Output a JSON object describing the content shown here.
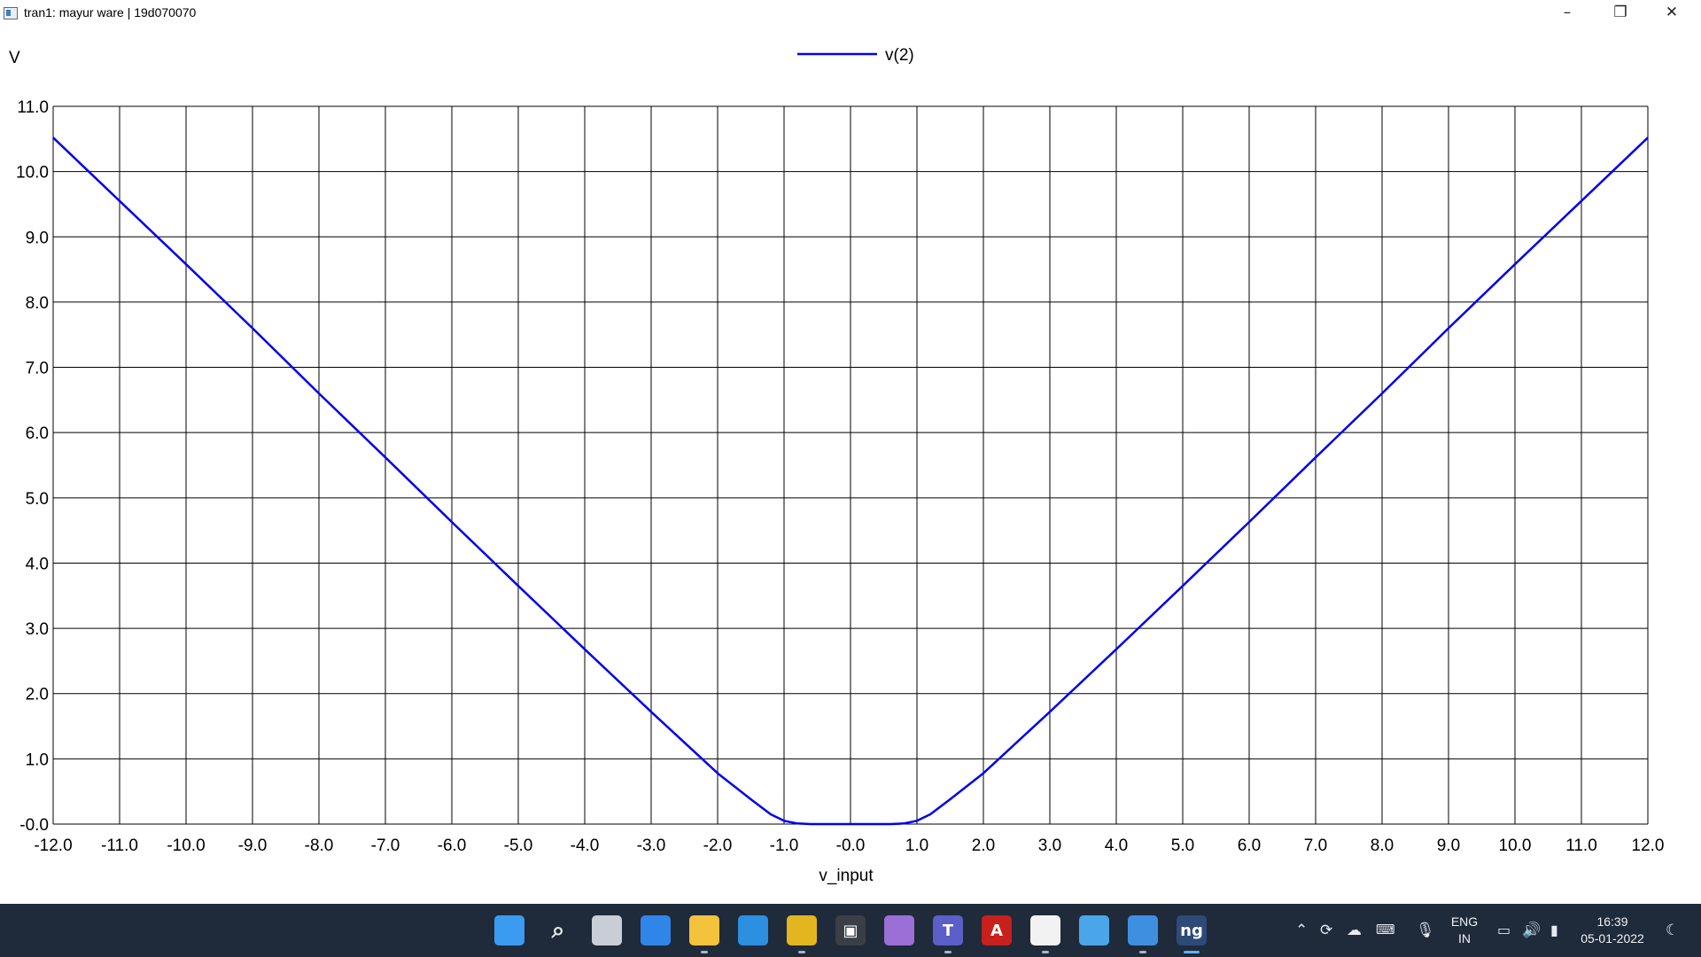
{
  "window": {
    "title": "tran1: mayur ware | 19d070070",
    "controls": {
      "minimize": "–",
      "maximize": "❐",
      "close": "✕"
    }
  },
  "chart_data": {
    "type": "line",
    "title": "",
    "xlabel": "v_input",
    "ylabel": "V",
    "xlim": [
      -12,
      12
    ],
    "ylim": [
      0,
      11
    ],
    "grid": true,
    "legend_position": "top-center",
    "x_ticks": [
      "-12.0",
      "-11.0",
      "-10.0",
      "-9.0",
      "-8.0",
      "-7.0",
      "-6.0",
      "-5.0",
      "-4.0",
      "-3.0",
      "-2.0",
      "-1.0",
      "-0.0",
      "1.0",
      "2.0",
      "3.0",
      "4.0",
      "5.0",
      "6.0",
      "7.0",
      "8.0",
      "9.0",
      "10.0",
      "11.0",
      "12.0"
    ],
    "y_ticks": [
      "-0.0",
      "1.0",
      "2.0",
      "3.0",
      "4.0",
      "5.0",
      "6.0",
      "7.0",
      "8.0",
      "9.0",
      "10.0",
      "11.0"
    ],
    "series": [
      {
        "name": "v(2)",
        "color": "#0000ee",
        "x": [
          -12,
          -11,
          -10,
          -9,
          -8,
          -7,
          -6,
          -5,
          -4,
          -3,
          -2,
          -1.5,
          -1.2,
          -1.0,
          -0.8,
          -0.6,
          0,
          0.6,
          0.8,
          1.0,
          1.2,
          1.5,
          2,
          3,
          4,
          5,
          6,
          7,
          8,
          9,
          10,
          11,
          12
        ],
        "y": [
          10.52,
          9.55,
          8.58,
          7.6,
          6.6,
          5.62,
          4.63,
          3.65,
          2.68,
          1.72,
          0.78,
          0.38,
          0.15,
          0.05,
          0.01,
          0.0,
          0.0,
          0.0,
          0.01,
          0.05,
          0.15,
          0.38,
          0.78,
          1.72,
          2.68,
          3.65,
          4.63,
          5.62,
          6.6,
          7.6,
          8.58,
          9.55,
          10.52
        ]
      }
    ]
  },
  "taskbar": {
    "apps": [
      {
        "name": "start-icon",
        "glyph": "",
        "color": "#3a9bf0"
      },
      {
        "name": "search-icon",
        "glyph": "⌕",
        "color": "#1f2a3a"
      },
      {
        "name": "task-view-icon",
        "glyph": "",
        "color": "#c9ced6"
      },
      {
        "name": "widgets-icon",
        "glyph": "",
        "color": "#2f86e8"
      },
      {
        "name": "file-explorer-icon",
        "glyph": "",
        "color": "#f4c23c"
      },
      {
        "name": "vscode-icon",
        "glyph": "",
        "color": "#2c8fe0"
      },
      {
        "name": "chrome-icon",
        "glyph": "",
        "color": "#e3b51f"
      },
      {
        "name": "terminal-icon",
        "glyph": "▣",
        "color": "#3a3f47"
      },
      {
        "name": "github-icon",
        "glyph": "",
        "color": "#9a6fd6"
      },
      {
        "name": "teams-icon",
        "glyph": "T",
        "color": "#5b5fc7"
      },
      {
        "name": "acrobat-icon",
        "glyph": "A",
        "color": "#c8201d"
      },
      {
        "name": "gtkwave-icon",
        "glyph": "",
        "color": "#f2f2f2"
      },
      {
        "name": "paint-icon",
        "glyph": "",
        "color": "#4aa6e8"
      },
      {
        "name": "notepad-icon",
        "glyph": "",
        "color": "#3f8fe0"
      },
      {
        "name": "ngspice-icon",
        "glyph": "ng",
        "color": "#2d4a78"
      }
    ],
    "language": "ENG",
    "region": "IN",
    "time": "16:39",
    "date": "05-01-2022"
  }
}
